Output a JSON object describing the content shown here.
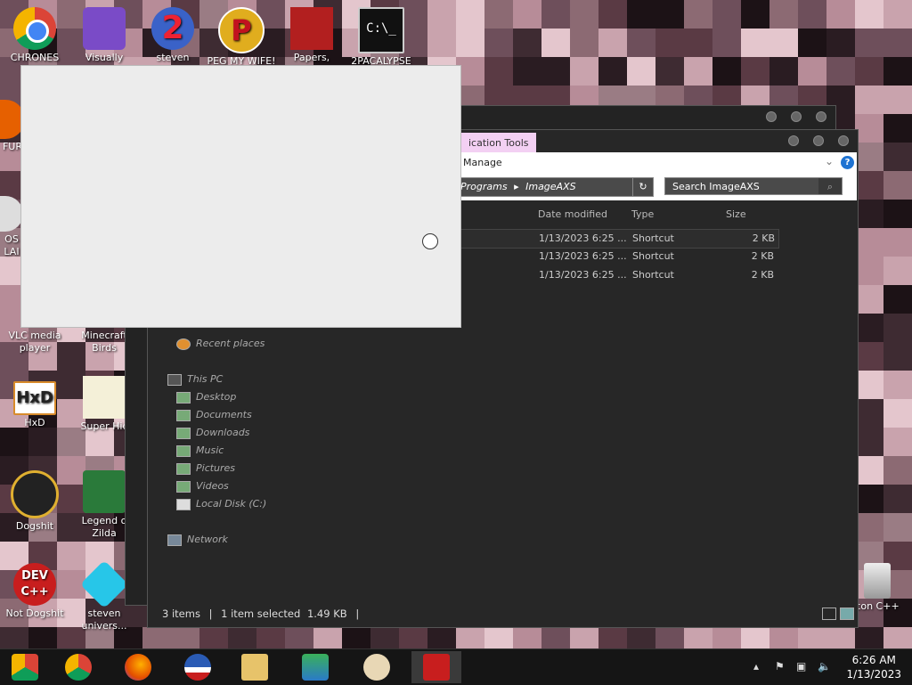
{
  "desktop": {
    "icons": [
      {
        "label": "CHRONES\nD...",
        "icon": "chrome-icon"
      },
      {
        "label": "Visually",
        "icon": "visual-studio-icon"
      },
      {
        "label": "steven",
        "icon": "steven-2-icon"
      },
      {
        "label": "PEG MY WIFE!",
        "icon": "p-game-icon"
      },
      {
        "label": "Papers,",
        "icon": "papers-please-icon"
      },
      {
        "label": "2PACALYPSE",
        "icon": "cmd-icon"
      },
      {
        "label": "FUR",
        "icon": "firefox-partial-icon"
      },
      {
        "label": "OS\nLAI",
        "icon": "os-icon"
      },
      {
        "label": "VLC media\nplayer",
        "icon": "vlc-icon"
      },
      {
        "label": "Minecraft\nBirds",
        "icon": "minecraft-birds-icon"
      },
      {
        "label": "HxD",
        "icon": "hxd-icon"
      },
      {
        "label": "Super Hic",
        "icon": "super-hic-icon"
      },
      {
        "label": "Dogshit",
        "icon": "dogshit-icon"
      },
      {
        "label": "Legend o\nZilda",
        "icon": "legend-zilda-icon"
      },
      {
        "label": "Not Dogshit",
        "icon": "dev-cpp-icon"
      },
      {
        "label": "steven\nunivers...",
        "icon": "gem-icon"
      },
      {
        "label": "con C++",
        "icon": "recycle-bin-icon"
      }
    ]
  },
  "explorer": {
    "ribbon_tab": "ication Tools",
    "manage_tab": "Manage",
    "breadcrumb_a": "Programs",
    "breadcrumb_b": "ImageAXS",
    "search_placeholder": "Search ImageAXS",
    "columns": {
      "date": "Date modified",
      "type": "Type",
      "size": "Size"
    },
    "rows": [
      {
        "date": "1/13/2023 6:25 ...",
        "type": "Shortcut",
        "size": "2 KB"
      },
      {
        "date": "1/13/2023 6:25 ...",
        "type": "Shortcut",
        "size": "2 KB"
      },
      {
        "date": "1/13/2023 6:25 ...",
        "type": "Shortcut",
        "size": "2 KB"
      }
    ],
    "nav": {
      "recent": "Recent places",
      "this_pc": "This PC",
      "desktop": "Desktop",
      "documents": "Documents",
      "downloads": "Downloads",
      "music": "Music",
      "pictures": "Pictures",
      "videos": "Videos",
      "local_disk": "Local Disk (C:)",
      "network": "Network"
    },
    "status": {
      "items": "3 items",
      "selected": "1 item selected",
      "size": "1.49 KB"
    }
  },
  "taskbar": {
    "time": "6:26 AM",
    "date": "1/13/2023",
    "tray_chevron": "▴"
  },
  "colors": {
    "accent": "#1e73d2",
    "ribbon_tab": "#f3d0f3"
  }
}
